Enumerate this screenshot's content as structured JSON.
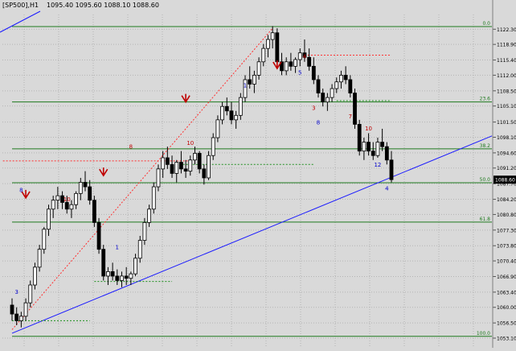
{
  "window": {
    "title": "[SP500],H1",
    "ohlc_text": "1095.40 1095.60 1088.10 1088.60"
  },
  "colors": {
    "background": "#d9d9d9",
    "grid": "#b4b4b4",
    "bull_candle": "#000000",
    "bear_candle": "#000000",
    "fib_line": "#1f7a1f",
    "trend_line": "#1a1aff",
    "dotted_red": "#ff3030",
    "dotted_green": "#1f8f1f",
    "label_red": "#c00000",
    "label_blue": "#0000cc",
    "last_price_bg": "#000000",
    "last_price_fg": "#ffffff"
  },
  "chart_data": {
    "type": "candlestick",
    "title": "",
    "xlabel": "",
    "ylabel": "",
    "symbol": "[SP500],H1",
    "ylim": [
      1053.1,
      1125.6
    ],
    "grid": true,
    "y_ticks": [
      1122.3,
      1118.9,
      1115.4,
      1112.0,
      1108.5,
      1105.1,
      1101.5,
      1098.1,
      1094.6,
      1091.2,
      1087.7,
      1084.2,
      1080.8,
      1077.3,
      1073.8,
      1070.4,
      1066.9,
      1063.4,
      1060.0,
      1056.5,
      1053.1
    ],
    "last_price": 1088.6,
    "fib_levels": [
      {
        "label": "0.0",
        "value": 1122.9
      },
      {
        "label": "23.6",
        "value": 1106.0
      },
      {
        "label": "38.2",
        "value": 1095.5
      },
      {
        "label": "50.0",
        "value": 1087.9
      },
      {
        "label": "61.8",
        "value": 1079.1
      },
      {
        "label": "100.0",
        "value": 1053.5
      }
    ],
    "candles": [
      [
        1060.5,
        1062.0,
        1057.0,
        1058.5
      ],
      [
        1058.5,
        1060.0,
        1056.0,
        1057.0
      ],
      [
        1057.0,
        1059.0,
        1055.5,
        1058.0
      ],
      [
        1058.0,
        1062.0,
        1057.0,
        1061.0
      ],
      [
        1061.0,
        1066.0,
        1060.0,
        1065.0
      ],
      [
        1065.0,
        1070.0,
        1064.0,
        1069.0
      ],
      [
        1069.0,
        1074.0,
        1068.0,
        1073.0
      ],
      [
        1073.0,
        1078.0,
        1072.0,
        1077.5
      ],
      [
        1077.5,
        1083.0,
        1076.0,
        1082.0
      ],
      [
        1082.0,
        1085.0,
        1080.0,
        1084.0
      ],
      [
        1084.0,
        1087.0,
        1082.0,
        1085.0
      ],
      [
        1085.0,
        1086.0,
        1082.0,
        1083.5
      ],
      [
        1083.5,
        1085.0,
        1081.0,
        1082.0
      ],
      [
        1082.0,
        1084.0,
        1080.0,
        1083.0
      ],
      [
        1083.0,
        1086.0,
        1082.0,
        1085.5
      ],
      [
        1085.5,
        1089.0,
        1084.0,
        1088.0
      ],
      [
        1088.0,
        1090.5,
        1086.0,
        1087.0
      ],
      [
        1087.0,
        1088.5,
        1083.0,
        1084.0
      ],
      [
        1084.0,
        1085.0,
        1078.0,
        1079.0
      ],
      [
        1079.0,
        1080.0,
        1072.0,
        1073.0
      ],
      [
        1073.0,
        1074.0,
        1066.0,
        1067.0
      ],
      [
        1067.0,
        1069.0,
        1065.0,
        1068.0
      ],
      [
        1068.0,
        1070.0,
        1066.0,
        1067.0
      ],
      [
        1067.0,
        1068.5,
        1065.0,
        1066.0
      ],
      [
        1066.0,
        1068.0,
        1064.5,
        1067.0
      ],
      [
        1067.0,
        1069.0,
        1065.0,
        1066.5
      ],
      [
        1066.5,
        1068.0,
        1065.0,
        1067.5
      ],
      [
        1067.5,
        1072.0,
        1067.0,
        1071.0
      ],
      [
        1071.0,
        1076.0,
        1070.0,
        1075.0
      ],
      [
        1075.0,
        1080.0,
        1074.0,
        1079.0
      ],
      [
        1079.0,
        1083.0,
        1078.0,
        1082.0
      ],
      [
        1082.0,
        1088.0,
        1081.0,
        1087.0
      ],
      [
        1087.0,
        1092.0,
        1086.0,
        1091.0
      ],
      [
        1091.0,
        1095.0,
        1089.0,
        1093.5
      ],
      [
        1093.5,
        1096.0,
        1091.0,
        1092.0
      ],
      [
        1092.0,
        1094.0,
        1089.0,
        1090.0
      ],
      [
        1090.0,
        1093.0,
        1088.0,
        1092.5
      ],
      [
        1092.5,
        1095.0,
        1090.0,
        1091.0
      ],
      [
        1091.0,
        1093.0,
        1089.0,
        1090.5
      ],
      [
        1090.5,
        1094.0,
        1089.5,
        1093.0
      ],
      [
        1093.0,
        1096.0,
        1092.0,
        1094.5
      ],
      [
        1094.5,
        1095.0,
        1090.0,
        1091.0
      ],
      [
        1091.0,
        1092.0,
        1087.5,
        1089.0
      ],
      [
        1089.0,
        1095.0,
        1088.5,
        1094.0
      ],
      [
        1094.0,
        1099.0,
        1093.0,
        1098.0
      ],
      [
        1098.0,
        1103.0,
        1097.0,
        1102.0
      ],
      [
        1102.0,
        1106.0,
        1101.0,
        1105.0
      ],
      [
        1105.0,
        1107.0,
        1103.0,
        1104.0
      ],
      [
        1104.0,
        1106.0,
        1101.0,
        1102.0
      ],
      [
        1102.0,
        1104.0,
        1100.0,
        1103.0
      ],
      [
        1103.0,
        1108.0,
        1102.0,
        1107.0
      ],
      [
        1107.0,
        1112.0,
        1106.0,
        1111.0
      ],
      [
        1111.0,
        1114.0,
        1109.0,
        1110.0
      ],
      [
        1110.0,
        1113.0,
        1108.0,
        1112.0
      ],
      [
        1112.0,
        1116.0,
        1111.0,
        1115.0
      ],
      [
        1115.0,
        1119.0,
        1114.0,
        1118.0
      ],
      [
        1118.0,
        1121.0,
        1116.0,
        1120.0
      ],
      [
        1120.0,
        1123.0,
        1118.0,
        1121.5
      ],
      [
        1121.5,
        1122.5,
        1114.0,
        1115.0
      ],
      [
        1115.0,
        1117.0,
        1112.0,
        1113.0
      ],
      [
        1113.0,
        1116.0,
        1112.0,
        1115.0
      ],
      [
        1115.0,
        1117.0,
        1113.0,
        1114.0
      ],
      [
        1114.0,
        1116.0,
        1112.5,
        1115.5
      ],
      [
        1115.5,
        1118.0,
        1114.0,
        1117.0
      ],
      [
        1117.0,
        1120.0,
        1115.0,
        1116.0
      ],
      [
        1116.0,
        1118.0,
        1113.0,
        1114.0
      ],
      [
        1114.0,
        1116.0,
        1110.0,
        1111.0
      ],
      [
        1111.0,
        1112.0,
        1107.0,
        1108.0
      ],
      [
        1108.0,
        1109.0,
        1105.0,
        1106.0
      ],
      [
        1106.0,
        1108.0,
        1104.0,
        1107.0
      ],
      [
        1107.0,
        1110.0,
        1106.0,
        1109.0
      ],
      [
        1109.0,
        1111.5,
        1108.0,
        1110.5
      ],
      [
        1110.5,
        1113.0,
        1109.0,
        1112.0
      ],
      [
        1112.0,
        1114.0,
        1110.0,
        1111.0
      ],
      [
        1111.0,
        1112.0,
        1107.0,
        1108.0
      ],
      [
        1108.0,
        1109.0,
        1100.0,
        1101.0
      ],
      [
        1101.0,
        1102.0,
        1094.0,
        1095.0
      ],
      [
        1095.0,
        1098.0,
        1093.0,
        1097.0
      ],
      [
        1097.0,
        1099.0,
        1094.0,
        1095.0
      ],
      [
        1095.0,
        1097.0,
        1093.0,
        1094.0
      ],
      [
        1094.0,
        1098.0,
        1093.5,
        1097.0
      ],
      [
        1097.0,
        1100.0,
        1095.0,
        1096.0
      ],
      [
        1096.0,
        1097.0,
        1092.0,
        1093.0
      ],
      [
        1093.0,
        1095.0,
        1088.0,
        1088.6
      ]
    ],
    "annotations": [
      {
        "text": "4",
        "value": 1115.8,
        "candle": 64,
        "color": "red"
      },
      {
        "text": "7",
        "value": 1102.3,
        "candle": 74,
        "color": "red"
      },
      {
        "text": "10",
        "value": 1099.6,
        "candle": 78,
        "color": "red"
      },
      {
        "text": "12",
        "value": 1091.5,
        "candle": 80,
        "color": "blue"
      },
      {
        "text": "4",
        "value": 1086.2,
        "candle": 82,
        "color": "blue"
      },
      {
        "text": "3",
        "value": 1104.2,
        "candle": 66,
        "color": "red"
      },
      {
        "text": "8",
        "value": 1101.0,
        "candle": 67,
        "color": "blue"
      },
      {
        "text": "5",
        "value": 1112.2,
        "candle": 63,
        "color": "blue"
      },
      {
        "text": "1",
        "value": 1109.3,
        "candle": 51,
        "color": "blue"
      },
      {
        "text": "8",
        "value": 1085.8,
        "candle": 2,
        "color": "blue"
      },
      {
        "text": "1",
        "value": 1073.0,
        "candle": 23,
        "color": "blue"
      },
      {
        "text": "10",
        "value": 1083.8,
        "candle": 12,
        "color": "red"
      },
      {
        "text": "3",
        "value": 1063.0,
        "candle": 1,
        "color": "blue"
      },
      {
        "text": "10",
        "value": 1096.4,
        "candle": 39,
        "color": "red"
      },
      {
        "text": "8",
        "value": 1095.6,
        "candle": 26,
        "color": "red"
      }
    ]
  },
  "y_axis_labels": [
    "1122.30",
    "1118.90",
    "1115.40",
    "1112.00",
    "1108.50",
    "1105.10",
    "1101.50",
    "1098.10",
    "1094.60",
    "1091.20",
    "1087.70",
    "1084.20",
    "1080.80",
    "1077.30",
    "1073.80",
    "1070.40",
    "1066.90",
    "1063.40",
    "1060.00",
    "1056.50",
    "1053.10"
  ],
  "fib_labels": [
    "0.0",
    "23.6",
    "38.2",
    "50.0",
    "61.8",
    "100.0"
  ],
  "last_price_label": "1088.60"
}
